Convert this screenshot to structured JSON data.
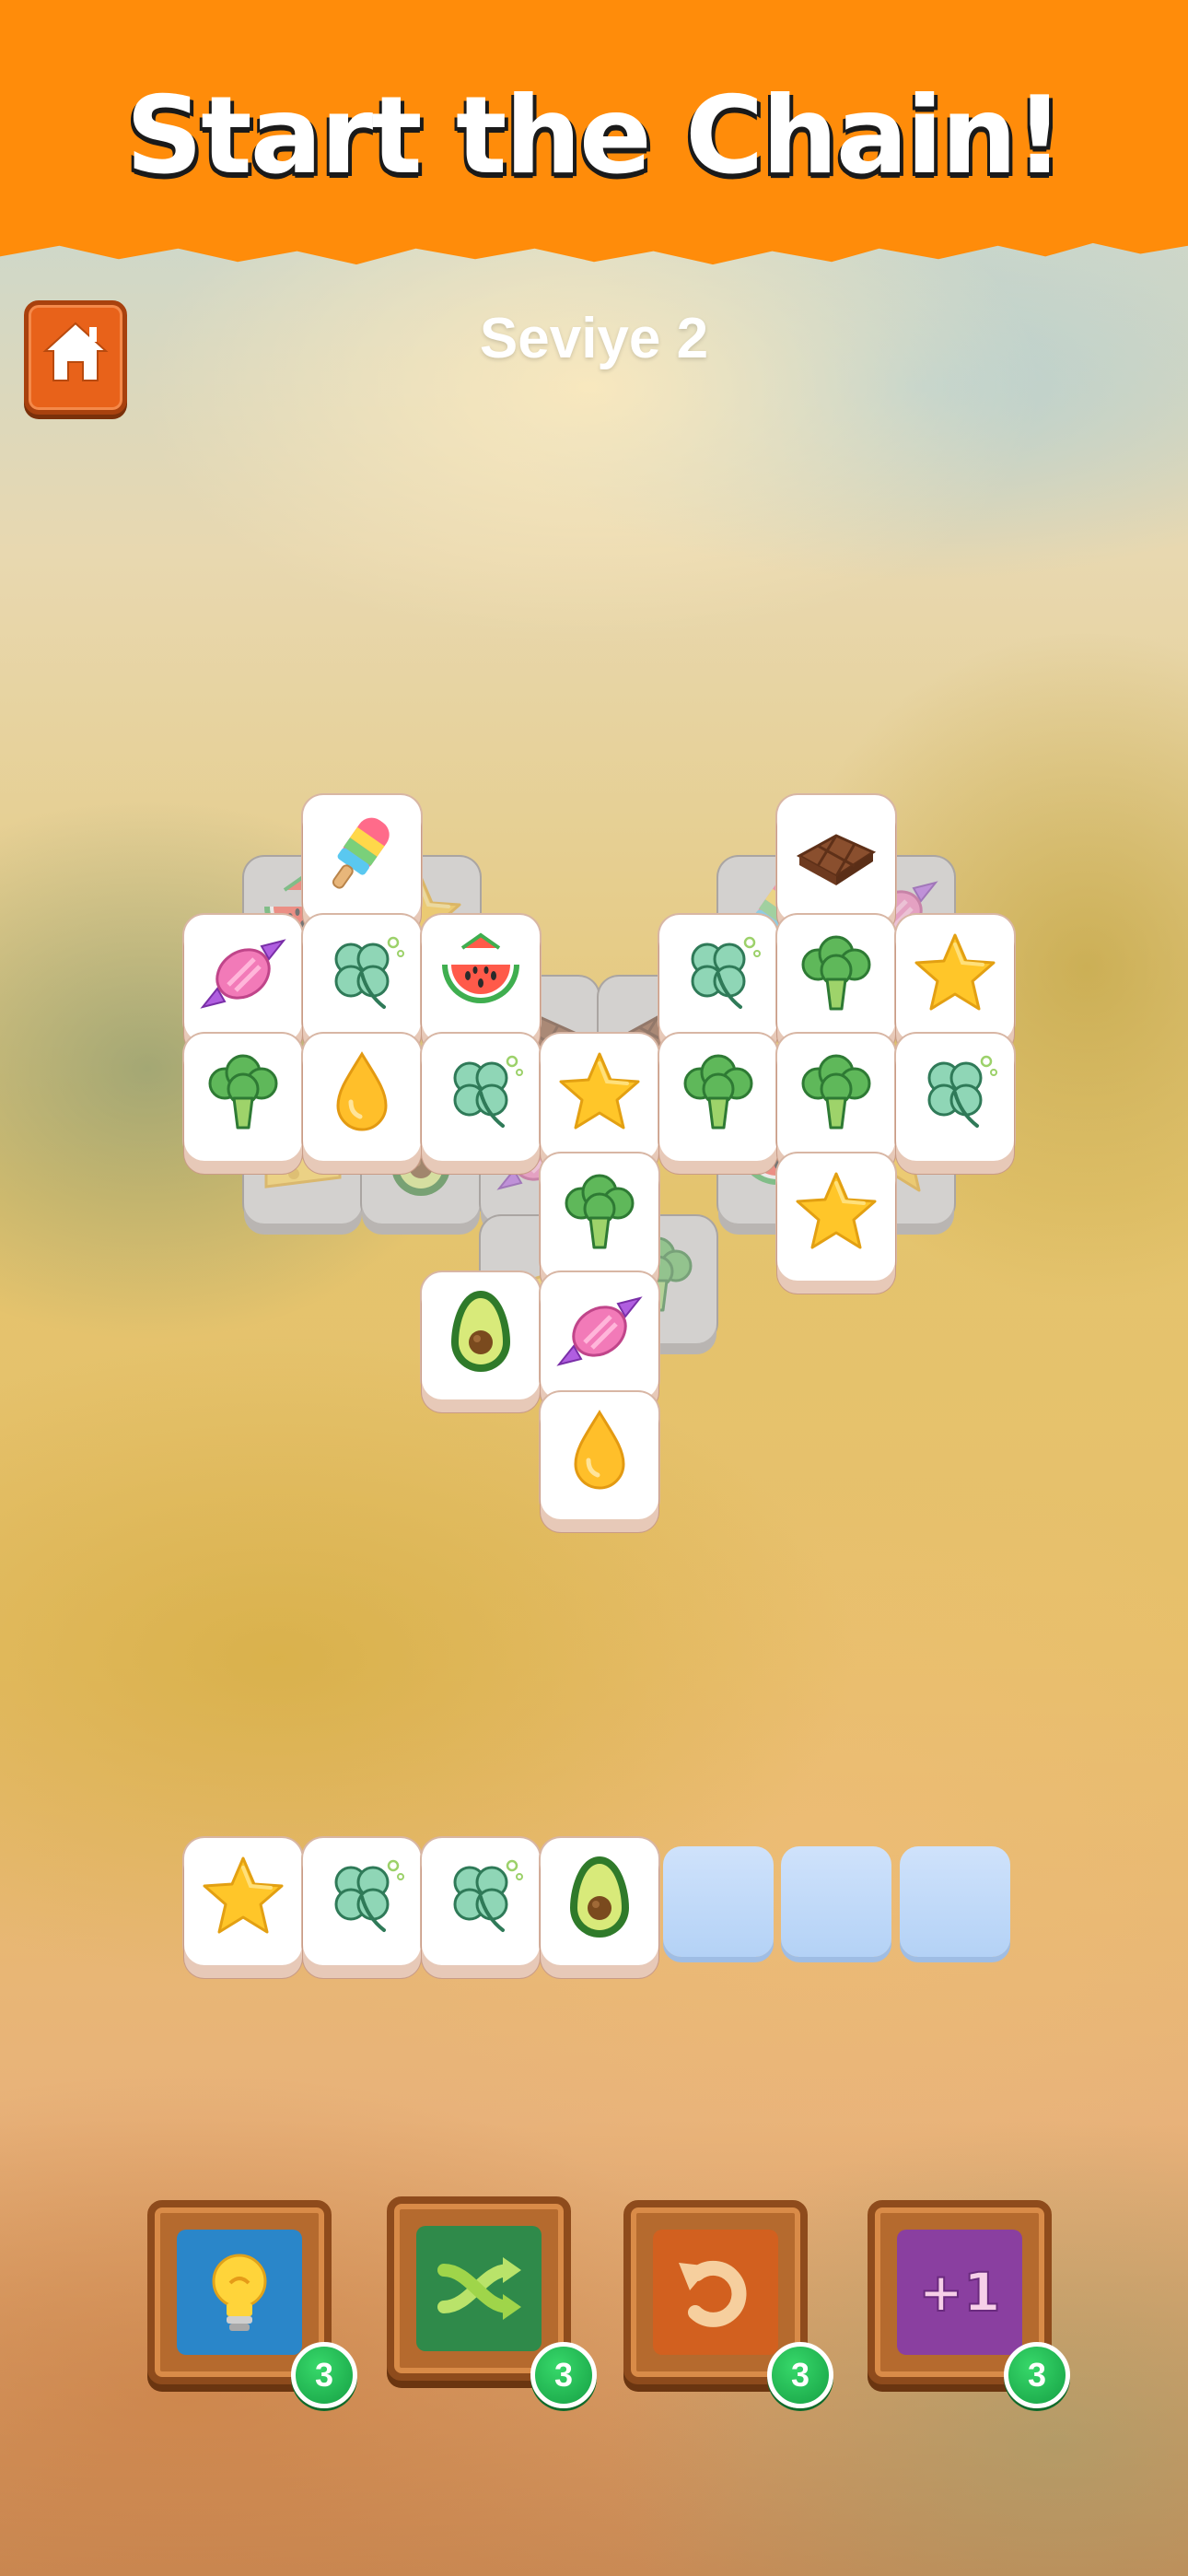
{
  "banner": {
    "title": "Start the Chain!"
  },
  "header": {
    "home_icon": "home-icon",
    "level_label": "Seviye 2"
  },
  "board": {
    "covered_tiles": [
      "watermelon",
      "star",
      "popsicle",
      "chocolate",
      "candy",
      "chocolate",
      "cheese",
      "avocado",
      "candy",
      "watermelon",
      "cheese",
      "broccoli",
      "star"
    ],
    "tiles": [
      "popsicle",
      "chocolate",
      "candy",
      "clover",
      "watermelon",
      "clover",
      "broccoli",
      "star",
      "broccoli",
      "oil-drop",
      "clover",
      "star",
      "broccoli",
      "broccoli",
      "clover",
      "broccoli",
      "star",
      "avocado",
      "candy",
      "oil-drop"
    ]
  },
  "tray": {
    "capacity": 7,
    "tiles": [
      "star",
      "clover",
      "clover",
      "avocado"
    ]
  },
  "boosters": [
    {
      "name": "hint",
      "icon": "lightbulb-icon",
      "count": "3",
      "color": "#2a86c9"
    },
    {
      "name": "shuffle",
      "icon": "shuffle-icon",
      "count": "3",
      "color": "#2f8a4a"
    },
    {
      "name": "undo",
      "icon": "undo-icon",
      "count": "3",
      "color": "#d2601f"
    },
    {
      "name": "extra-slot",
      "icon": "plus-one-icon",
      "label": "+1",
      "count": "3",
      "color": "#8a3fa0"
    }
  ],
  "colors": {
    "banner": "#ff8c0a",
    "home_button": "#e8621a",
    "badge": "#1fb84f"
  }
}
